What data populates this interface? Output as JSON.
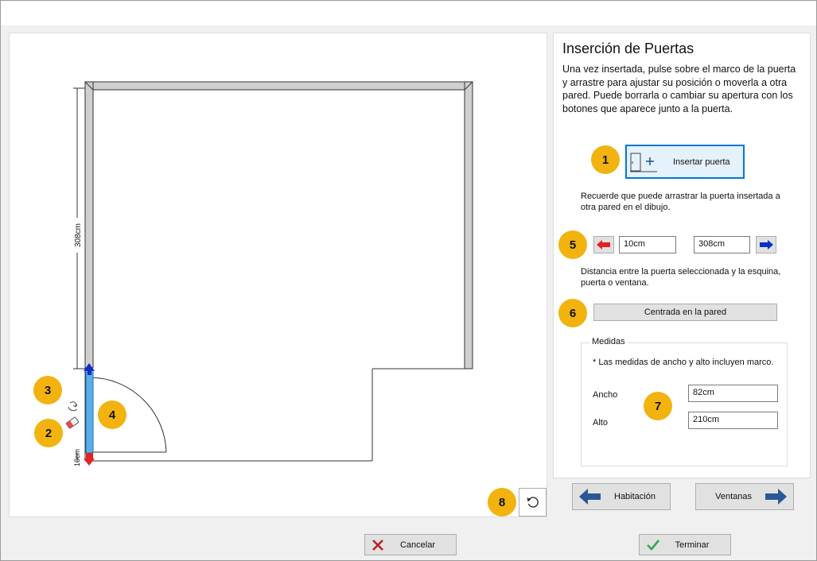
{
  "panel": {
    "title": "Inserción de Puertas",
    "description": "Una vez insertada, pulse sobre el marco de la puerta y arrastre para ajustar su posición o moverla a otra pared. Puede borrarla o cambiar su apertura con los botones que aparece junto a la puerta.",
    "insert_button_label": "Insertar puerta",
    "drag_hint": "Recuerde que puede arrastrar la puerta insertada a otra pared en el dibujo.",
    "left_distance": "10cm",
    "right_distance": "308cm",
    "distance_hint": "Distancia entre la puerta seleccionada y la esquina, puerta o ventana.",
    "center_button_label": "Centrada en la pared",
    "measures": {
      "legend": "Medidas",
      "note": "* Las medidas de ancho y alto incluyen marco.",
      "width_label": "Ancho",
      "width_value": "82cm",
      "height_label": "Alto",
      "height_value": "210cm"
    }
  },
  "nav": {
    "back_label": "Habitación",
    "next_label": "Ventanas"
  },
  "footer": {
    "cancel_label": "Cancelar",
    "finish_label": "Terminar"
  },
  "drawing": {
    "wall_dimension": "308cm",
    "door_offset_dimension": "10cm"
  },
  "badges": [
    "1",
    "2",
    "3",
    "4",
    "5",
    "6",
    "7",
    "8"
  ],
  "icons": {
    "left_arrow": "red-left-arrow-icon",
    "right_arrow": "blue-right-arrow-icon",
    "flip": "flip-door-icon",
    "erase": "eraser-icon",
    "undo": "undo-icon",
    "cancel": "red-x-icon",
    "finish": "green-check-icon"
  },
  "colors": {
    "badge": "#f2b30f",
    "accent": "#0078d7",
    "nav_arrow": "#2b5797",
    "door_frame": "#59b0e6"
  }
}
